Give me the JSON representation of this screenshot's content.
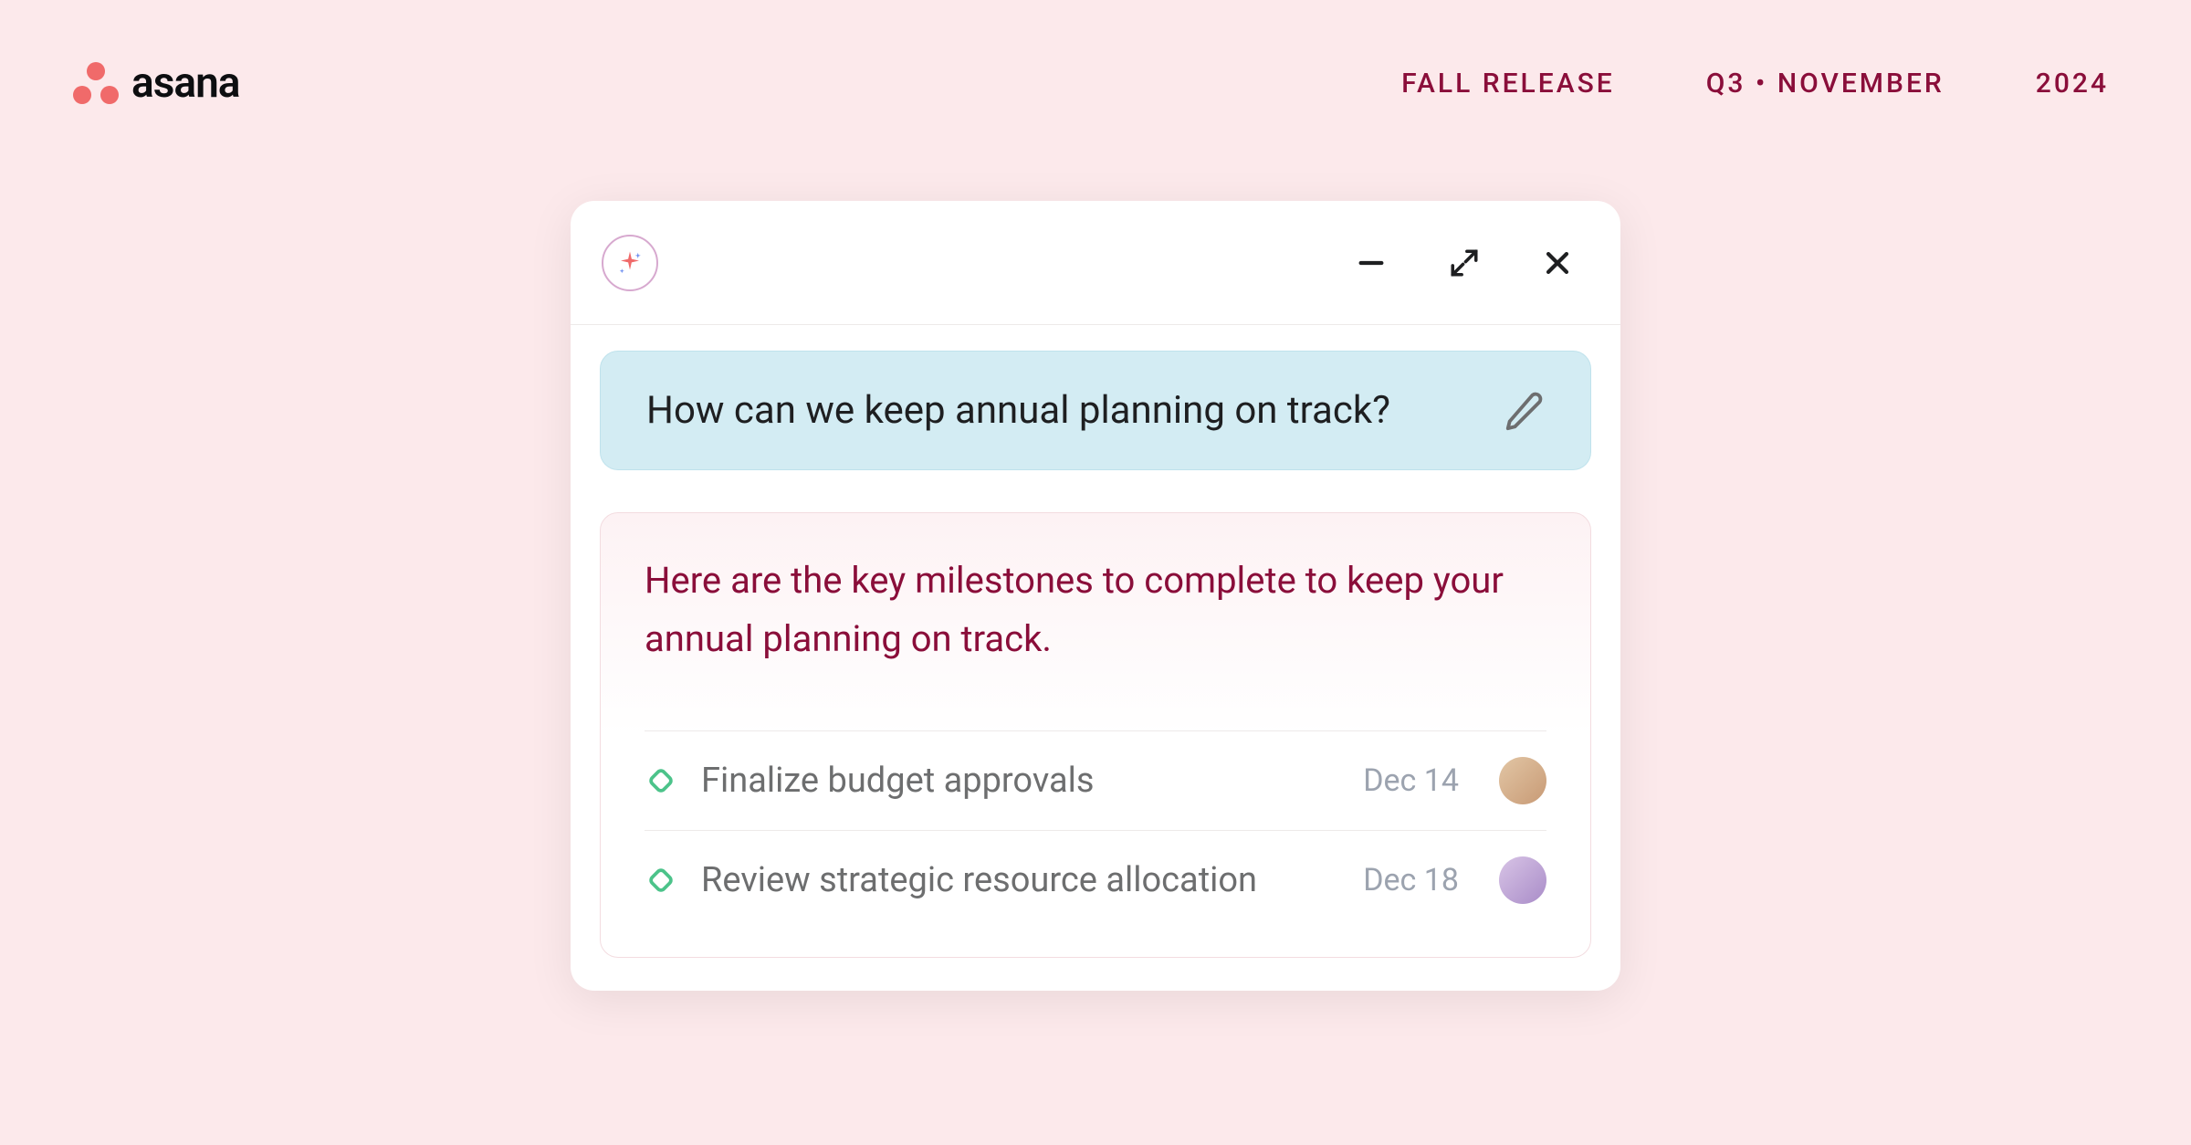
{
  "header": {
    "brand": "asana",
    "meta": {
      "release": "FALL RELEASE",
      "quarter": "Q3 • NOVEMBER",
      "year": "2024"
    }
  },
  "modal": {
    "prompt": "How can we keep annual planning on track?",
    "answer": "Here are the key milestones to complete to keep your annual planning on track.",
    "milestones": [
      {
        "title": "Finalize budget approvals",
        "date": "Dec 14"
      },
      {
        "title": "Review strategic resource allocation",
        "date": "Dec 18"
      }
    ]
  },
  "colors": {
    "page_bg": "#fce9eb",
    "brand_accent": "#f06a6a",
    "meta_text": "#8a0e3a",
    "prompt_bg": "#d3ecf3",
    "answer_text": "#8a0e3a",
    "milestone_accent": "#4cc38a"
  }
}
